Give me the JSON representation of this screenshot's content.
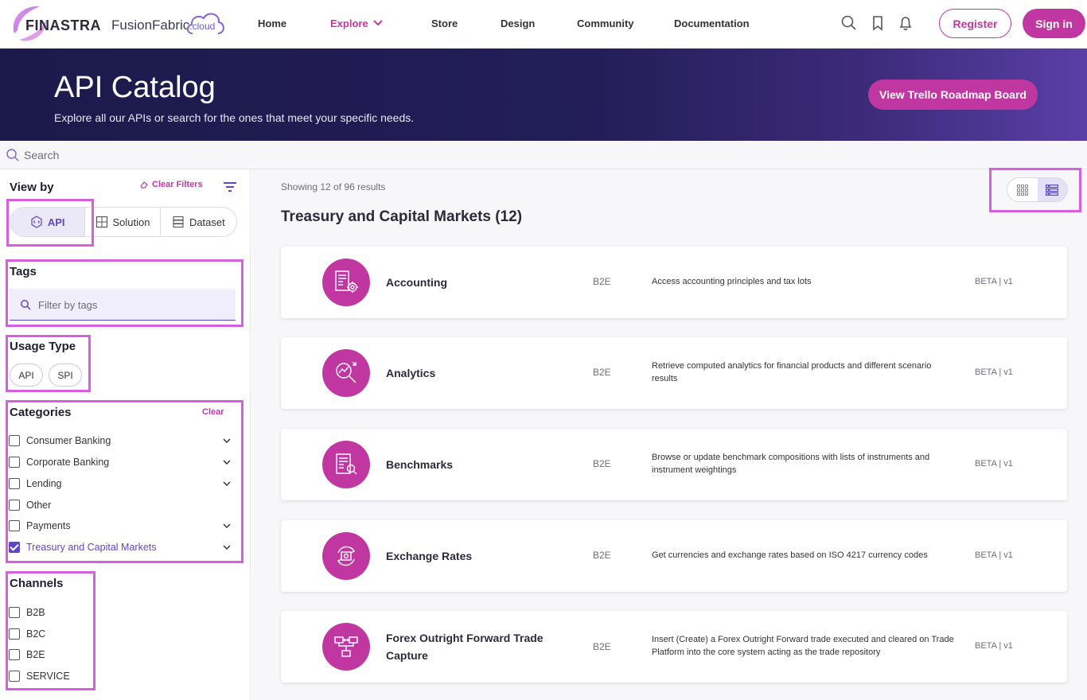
{
  "nav": {
    "brand": "FINASTRA",
    "fusion_brand": "FusionFabric",
    "fusion_suffix": ".cloud",
    "links": [
      "Home",
      "Explore",
      "Store",
      "Design",
      "Community",
      "Documentation"
    ],
    "active_link": "Explore",
    "register_label": "Register",
    "signin_label": "Sign in"
  },
  "hero": {
    "title": "API Catalog",
    "subtitle": "Explore all our APIs or search for the ones that meet your specific needs.",
    "button_label": "View Trello Roadmap Board"
  },
  "search": {
    "placeholder": "Search"
  },
  "sidebar": {
    "view_by_title": "View by",
    "clear_filters_label": "Clear Filters",
    "view_by_options": [
      "API",
      "Solution",
      "Dataset"
    ],
    "view_by_selected": "API",
    "tags_title": "Tags",
    "tags_placeholder": "Filter by tags",
    "usage_type_title": "Usage Type",
    "usage_types": [
      "API",
      "SPI"
    ],
    "categories_title": "Categories",
    "categories_clear": "Clear",
    "categories": [
      {
        "label": "Consumer Banking",
        "checked": false,
        "expandable": true
      },
      {
        "label": "Corporate Banking",
        "checked": false,
        "expandable": true
      },
      {
        "label": "Lending",
        "checked": false,
        "expandable": true
      },
      {
        "label": "Other",
        "checked": false,
        "expandable": false
      },
      {
        "label": "Payments",
        "checked": false,
        "expandable": true
      },
      {
        "label": "Treasury and Capital Markets",
        "checked": true,
        "expandable": true
      }
    ],
    "channels_title": "Channels",
    "channels": [
      {
        "label": "B2B",
        "checked": false
      },
      {
        "label": "B2C",
        "checked": false
      },
      {
        "label": "B2E",
        "checked": false
      },
      {
        "label": "SERVICE",
        "checked": false
      }
    ]
  },
  "main": {
    "showing": "Showing 12 of 96 results",
    "group_title": "Treasury and Capital Markets (12)",
    "view_mode": "list",
    "apis": [
      {
        "name": "Accounting",
        "channel": "B2E",
        "description": "Access accounting principles and tax lots",
        "version": "BETA | v1",
        "icon": "accounting-icon"
      },
      {
        "name": "Analytics",
        "channel": "B2E",
        "description": "Retrieve computed analytics for financial products and different scenario results",
        "version": "BETA | v1",
        "icon": "analytics-icon"
      },
      {
        "name": "Benchmarks",
        "channel": "B2E",
        "description": "Browse or update benchmark compositions with lists of instruments and instrument weightings",
        "version": "BETA | v1",
        "icon": "benchmarks-icon"
      },
      {
        "name": "Exchange Rates",
        "channel": "B2E",
        "description": "Get currencies and exchange rates based on ISO 4217 currency codes",
        "version": "BETA | v1",
        "icon": "exchange-rates-icon"
      },
      {
        "name": "Forex Outright Forward Trade Capture",
        "channel": "B2E",
        "description": "Insert (Create) a Forex Outright Forward trade executed and cleared on Trade Platform into the core system acting as the trade repository",
        "version": "BETA | v1",
        "icon": "forex-trade-icon"
      }
    ]
  },
  "colors": {
    "accent": "#c137a2",
    "primary": "#5a48c9",
    "hero_dark": "#1c1a4b",
    "highlight": "#d65fe0"
  }
}
